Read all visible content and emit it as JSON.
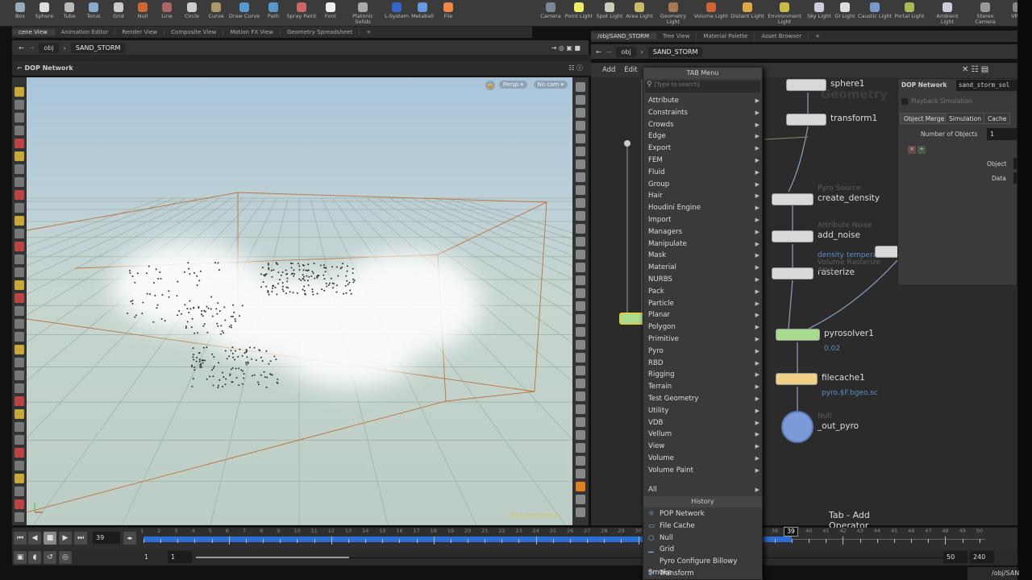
{
  "shelf_left": [
    "Box",
    "Sphere",
    "Tube",
    "Torus",
    "Grid",
    "Null",
    "Line",
    "Circle",
    "Curve",
    "Draw Curve",
    "Path",
    "Spray Paint",
    "Font",
    "Platonic Solids",
    "L-System",
    "Metaball",
    "File"
  ],
  "shelf_right": [
    "Camera",
    "Point Light",
    "Spot Light",
    "Area Light",
    "Geometry Light",
    "Volume Light",
    "Distant Light",
    "Environment Light",
    "Sky Light",
    "GI Light",
    "Caustic Light",
    "Portal Light",
    "Ambient Light",
    "Stereo Camera",
    "VR C"
  ],
  "left_tabs": [
    "cene View",
    "Animation Editor",
    "Render View",
    "Composite View",
    "Motion FX View",
    "Geometry Spreadsheet"
  ],
  "right_tabs": [
    "/obj/SAND_STORM",
    "Tree View",
    "Material Palette",
    "Asset Browser"
  ],
  "path": {
    "root": "obj",
    "current": "SAND_STORM"
  },
  "viewport": {
    "network_label": "DOP Network",
    "persp": "Persp ▾",
    "cam": "No cam ▾",
    "edition": "Education Edition"
  },
  "network": {
    "menu": [
      "Add",
      "Edit"
    ],
    "context_watermark": "Geometry",
    "nodes": [
      {
        "name": "sphere1",
        "type": "",
        "value": ""
      },
      {
        "name": "transform1",
        "type": "",
        "value": ""
      },
      {
        "name": "create_density",
        "type": "Pyro Source",
        "value": ""
      },
      {
        "name": "add_noise",
        "type": "Attribute Noise",
        "value": "density temperature"
      },
      {
        "name": "rasterize",
        "type": "Volume Rasterize Attri",
        "value": ""
      },
      {
        "name": "pyrosolver1",
        "type": "",
        "value": "0.02"
      },
      {
        "name": "filecache1",
        "type": "",
        "value": "pyro.$F.bgeo.sc"
      },
      {
        "name": "_out_pyro",
        "type": "Null",
        "value": ""
      }
    ],
    "status": "Tab - Add Operator"
  },
  "tab_menu": {
    "title": "TAB Menu",
    "search_placeholder": "[Type to search]",
    "categories": [
      "Attribute",
      "Constraints",
      "Crowds",
      "Edge",
      "Export",
      "FEM",
      "Fluid",
      "Group",
      "Hair",
      "Houdini Engine",
      "Import",
      "Managers",
      "Manipulate",
      "Mask",
      "Material",
      "NURBS",
      "Pack",
      "Particle",
      "Planar",
      "Polygon",
      "Primitive",
      "Pyro",
      "RBD",
      "Rigging",
      "Terrain",
      "Test Geometry",
      "Utility",
      "VDB",
      "Vellum",
      "View",
      "Volume",
      "Volume Paint"
    ],
    "all": "All",
    "history_title": "History",
    "history": [
      "POP Network",
      "File Cache",
      "Null",
      "Grid",
      "Pyro Configure Billowy Smoke",
      "Transform"
    ]
  },
  "params": {
    "type": "DOP Network",
    "name": "sand_storm_sol",
    "playback": "Playback Simulation",
    "tabs": [
      "Object Merge",
      "Simulation",
      "Cache"
    ],
    "num_objects_label": "Number of Objects",
    "num_objects": "1",
    "object_label": "Object",
    "data_label": "Data"
  },
  "timeline": {
    "current_frame": "39",
    "start": 1,
    "end": 50,
    "range_start": "1",
    "range_start2": "1",
    "range_end": "50",
    "range_end2": "240"
  },
  "bottom_path": "/obj/SAN",
  "colors": {
    "accent": "#2a6fd6",
    "solver": "#a7dc8f",
    "cache": "#f0cf86"
  }
}
